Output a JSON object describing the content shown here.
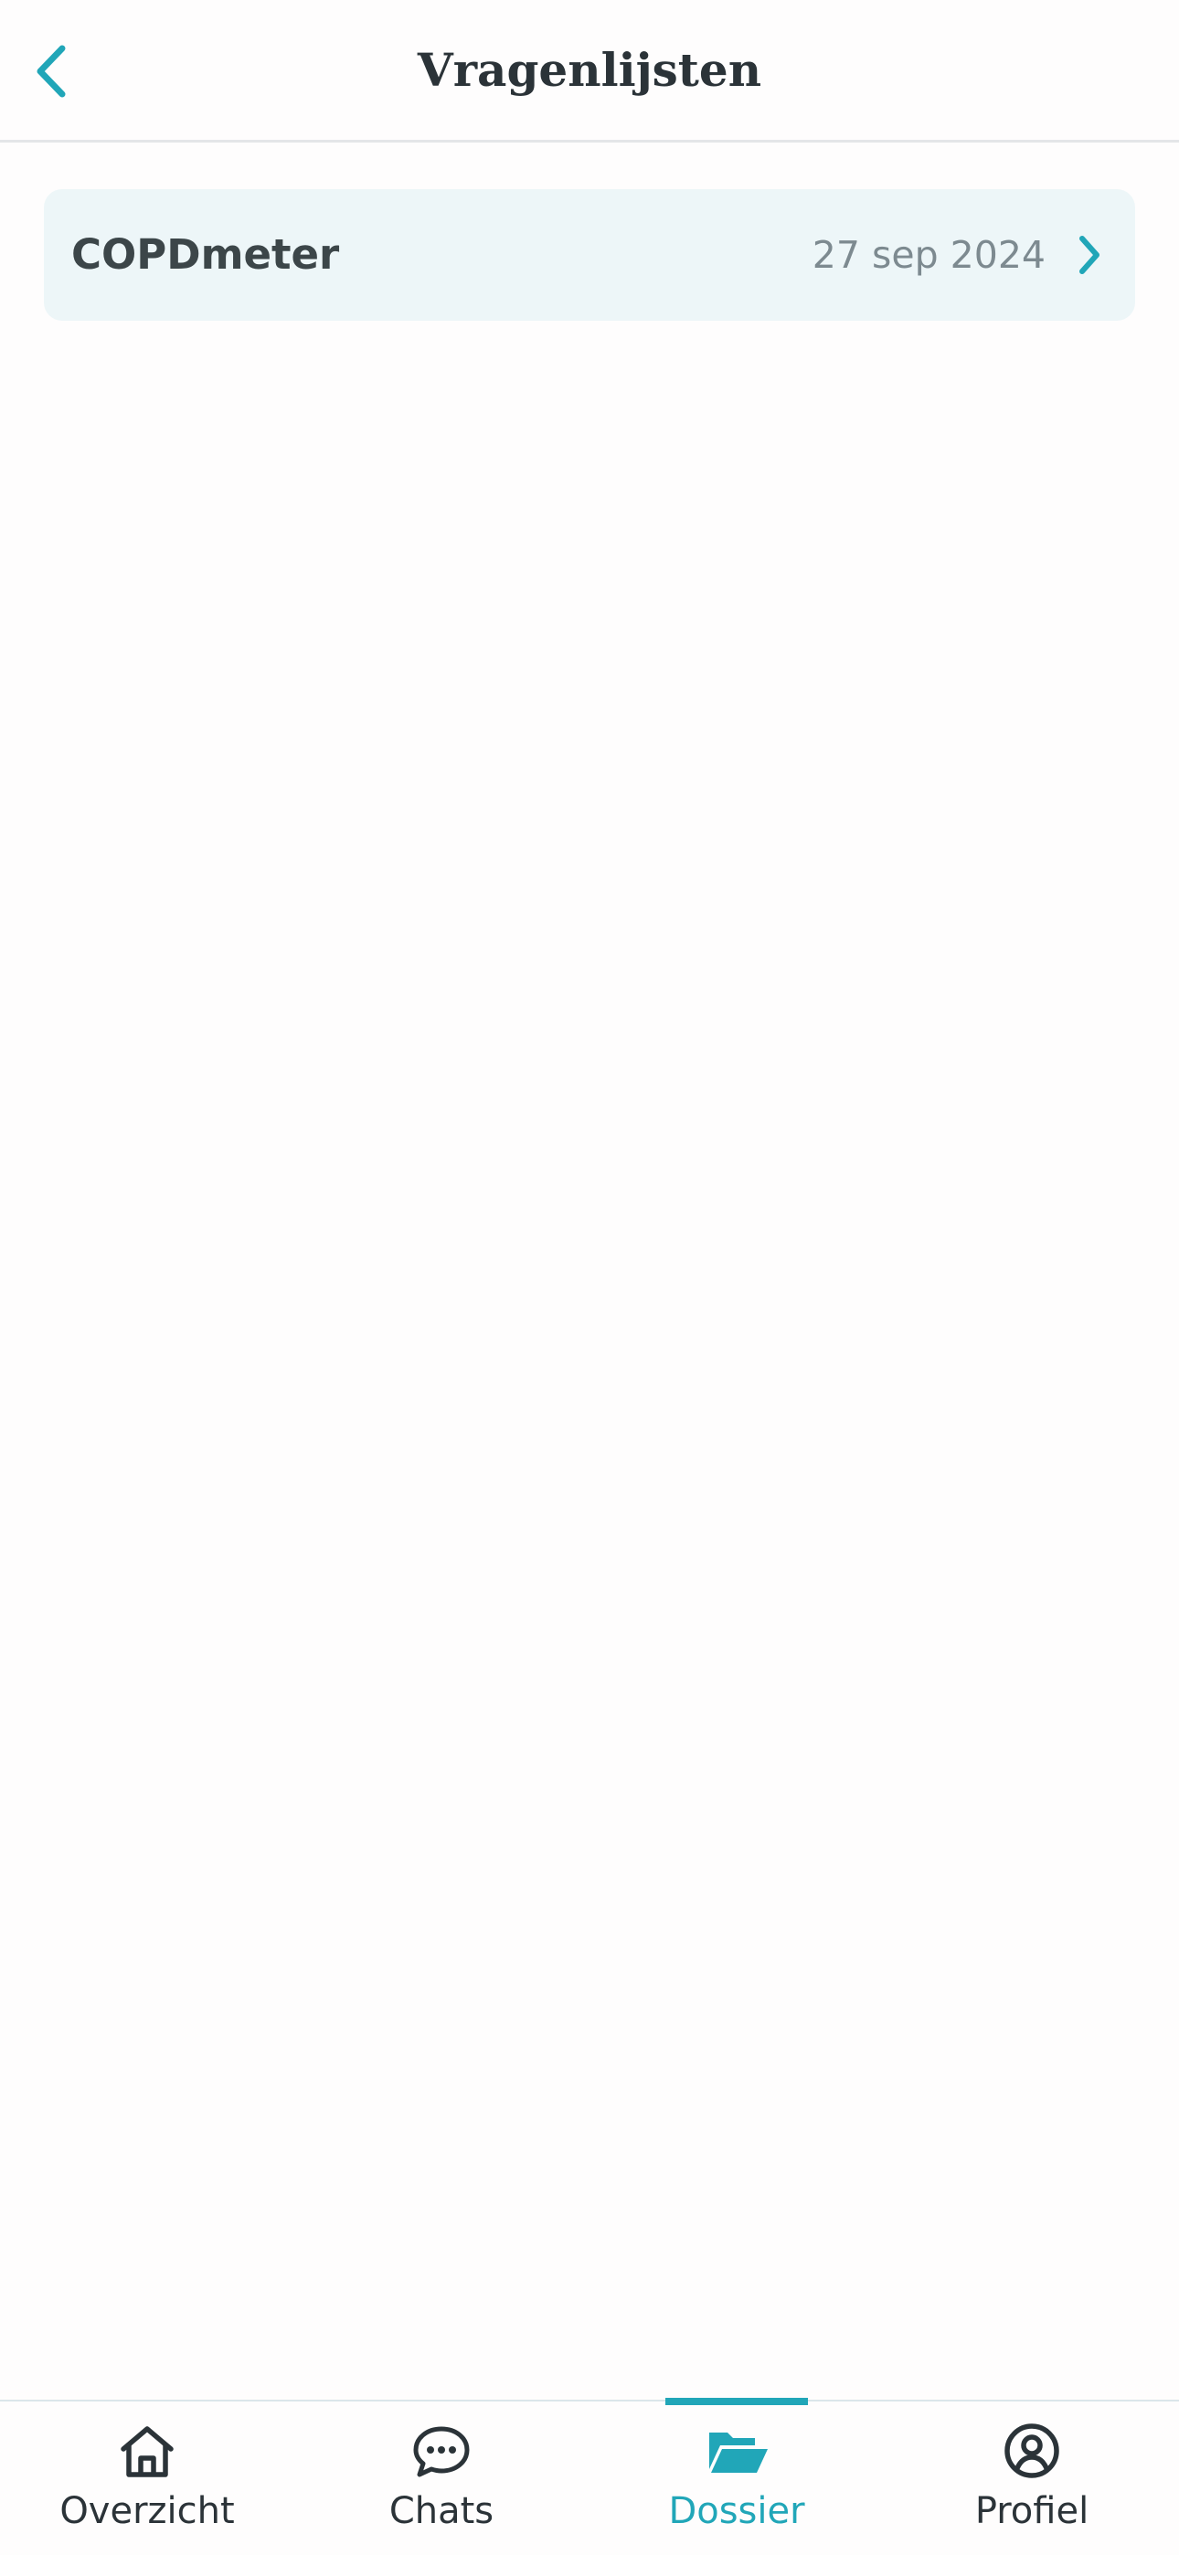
{
  "header": {
    "title": "Vragenlijsten",
    "back_icon": "chevron-left-icon"
  },
  "questionnaires": [
    {
      "title": "COPDmeter",
      "date": "27 sep 2024",
      "icon": "chevron-right-icon"
    }
  ],
  "tabbar": {
    "active": "Dossier",
    "tabs": [
      {
        "label": "Overzicht",
        "icon": "home-icon"
      },
      {
        "label": "Chats",
        "icon": "chat-bubble-icon"
      },
      {
        "label": "Dossier",
        "icon": "folder-open-icon"
      },
      {
        "label": "Profiel",
        "icon": "user-circle-icon"
      }
    ]
  },
  "colors": {
    "accent": "#21a6b8",
    "text": "#2b3338",
    "item_background": "#edf6f8",
    "muted": "#7d8a90"
  }
}
